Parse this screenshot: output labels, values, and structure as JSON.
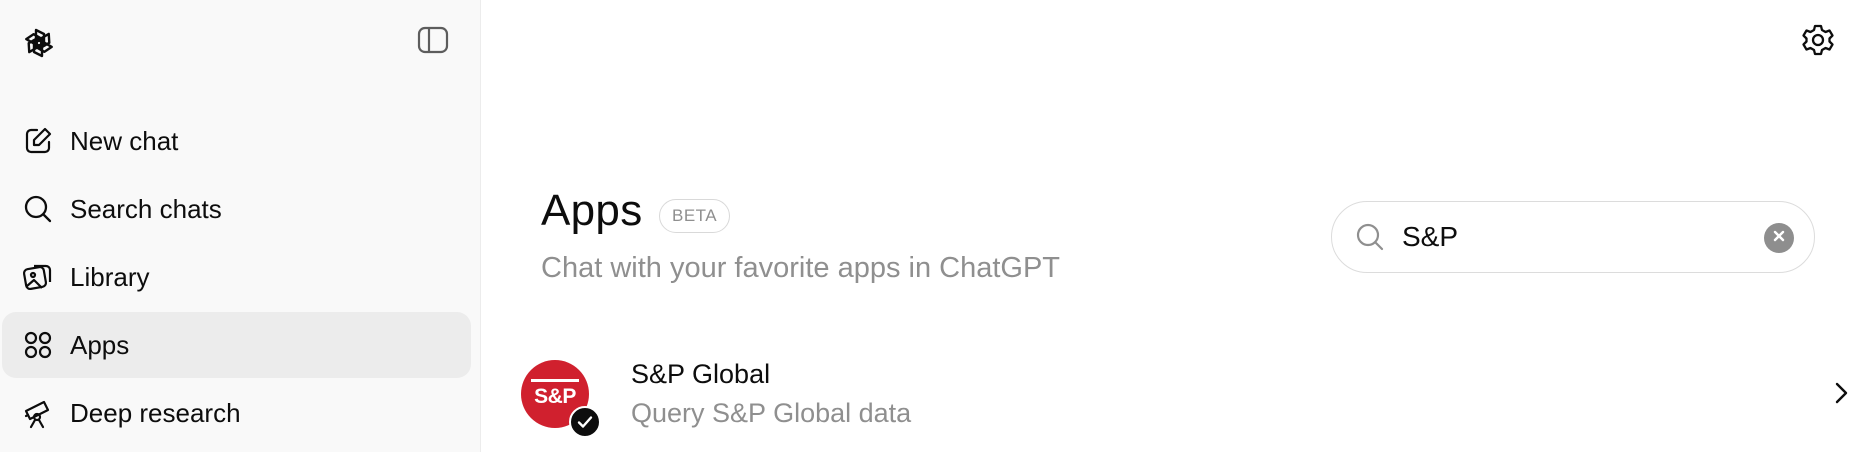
{
  "sidebar": {
    "logo_icon": "openai-logo-icon",
    "toggle_icon": "sidebar-toggle-icon",
    "items": [
      {
        "label": "New chat",
        "icon": "compose-icon",
        "active": false
      },
      {
        "label": "Search chats",
        "icon": "search-icon",
        "active": false
      },
      {
        "label": "Library",
        "icon": "library-icon",
        "active": false
      },
      {
        "label": "Apps",
        "icon": "apps-grid-icon",
        "active": true
      },
      {
        "label": "Deep research",
        "icon": "telescope-icon",
        "active": false
      }
    ]
  },
  "header": {
    "settings_icon": "gear-icon"
  },
  "main": {
    "title": "Apps",
    "badge": "BETA",
    "subtitle": "Chat with your favorite apps in ChatGPT",
    "search": {
      "value": "S&P",
      "placeholder": "",
      "icon": "search-icon",
      "clear_icon": "clear-icon"
    },
    "results": [
      {
        "name": "S&P Global",
        "description": "Query S&P Global data",
        "logo_text": "S&P",
        "connected": true
      }
    ]
  },
  "colors": {
    "sidebar_bg": "#f9f9f9",
    "active_item_bg": "#ececec",
    "brand_red": "#d0202e",
    "muted_text": "#8f8f8f"
  }
}
